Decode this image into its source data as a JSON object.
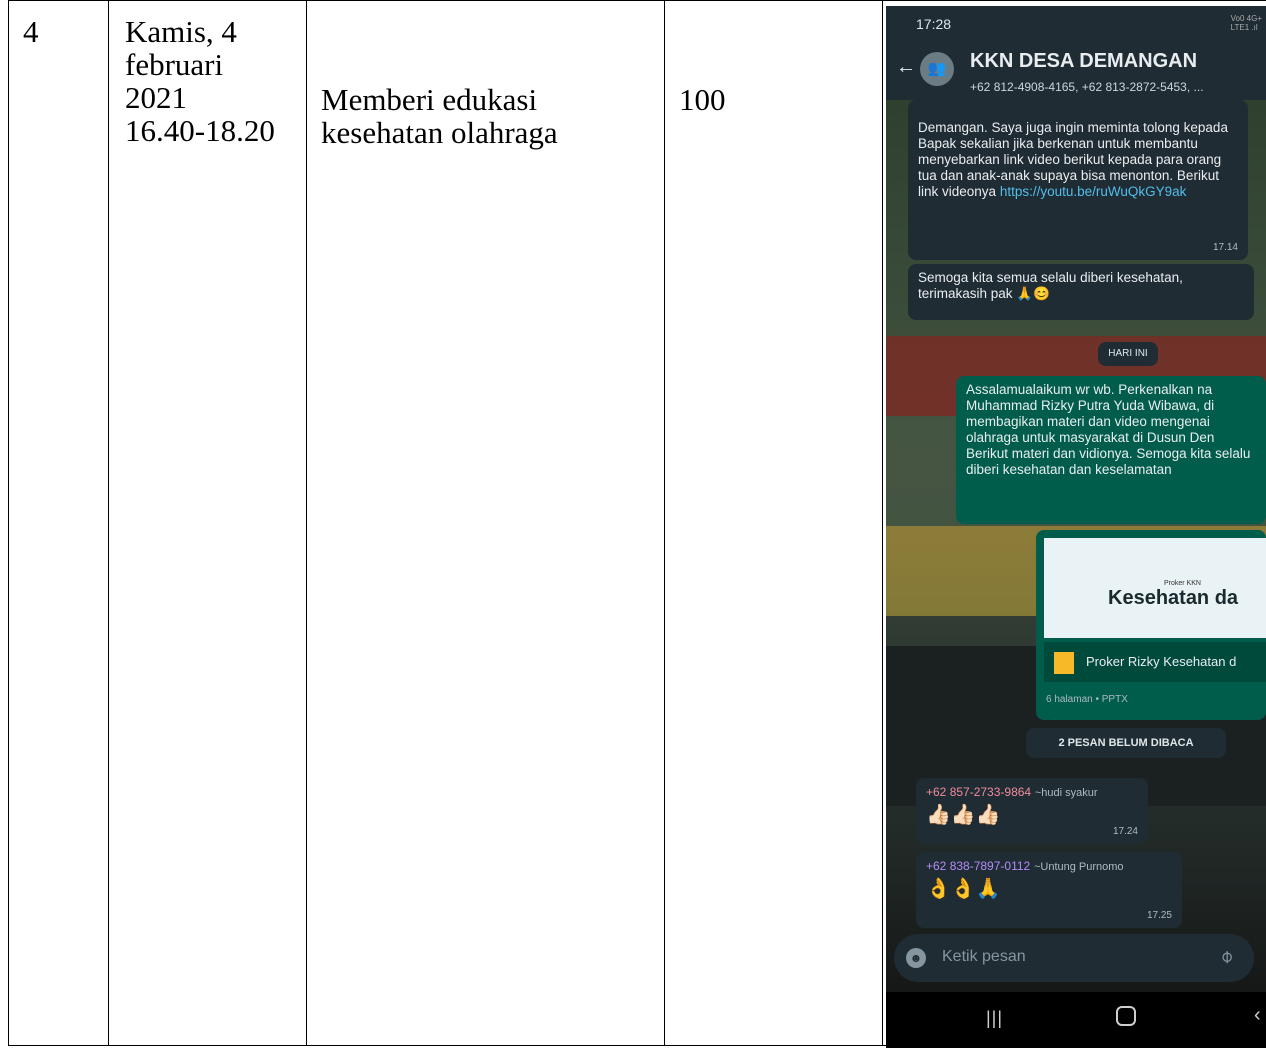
{
  "table_row": {
    "no": "4",
    "date": "Kamis, 4\nfebruari\n2021\n16.40-18.20",
    "activity": "Memberi edukasi\nkesehatan olahraga",
    "count": "100"
  },
  "phone": {
    "status_time": "17:28",
    "status_net": "Vo0 4G+\nLTE1 .ıl",
    "group_name": "KKN DESA DEMANGAN",
    "group_members": "+62 812-4908-4165, +62 813-2872-5453, ...",
    "msg1_text": "Demangan. Saya juga ingin meminta tolong kepada Bapak sekalian jika berkenan untuk membantu menyebarkan link video berikut kepada para orang tua dan anak-anak supaya bisa menonton. Berikut link videonya ",
    "msg1_link": "https://youtu.be/ruWuQkGY9ak",
    "msg1_time": "17.14",
    "msg2_text": "Semoga kita semua selalu diberi kesehatan, terimakasih pak 🙏😊",
    "today_label": "HARI INI",
    "msg3_text": "Assalamualaikum wr wb. Perkenalkan na Muhammad Rizky Putra Yuda Wibawa, di membagikan materi dan video mengenai olahraga untuk masyarakat di Dusun Den Berikut materi dan vidionya. Semoga kita selalu diberi kesehatan dan keselamatan",
    "slide_tag": "Proker KKN",
    "slide_title": "Kesehatan da",
    "file_name": "Proker Rizky Kesehatan d",
    "file_meta": "6 halaman • PPTX",
    "unread_label": "2 PESAN BELUM DIBACA",
    "msg5_sender": "+62 857-2733-9864",
    "msg5_name": "~hudi syakur",
    "msg5_emoji": "👍🏻👍🏻👍🏻",
    "msg5_time": "17.24",
    "msg6_sender": "+62 838-7897-0112",
    "msg6_name": "~Untung Purnomo",
    "msg6_emoji": "👌👌🙏",
    "msg6_time": "17.25",
    "input_placeholder": "Ketik pesan"
  }
}
